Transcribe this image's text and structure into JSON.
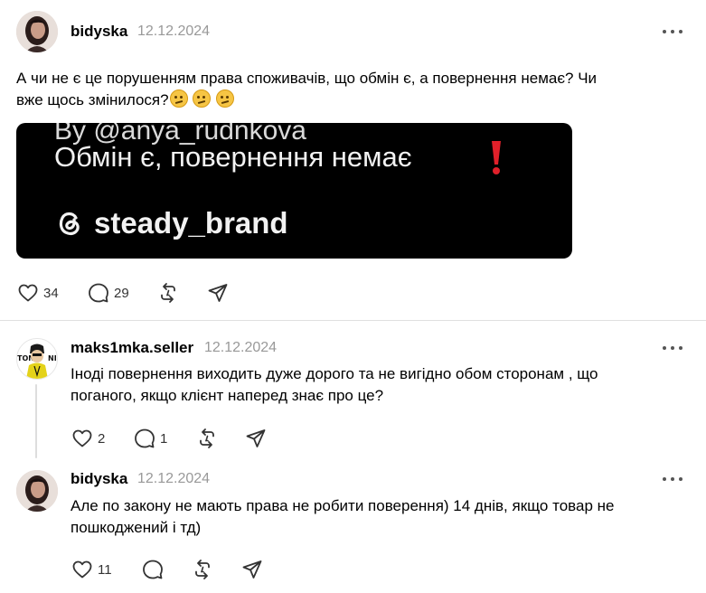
{
  "posts": [
    {
      "username": "bidyska",
      "date": "12.12.2024",
      "text_line1": "А чи не є це порушенням права споживачів, що обмін є, а повернення немає? Чи",
      "text_line2": "вже щось змінилося?",
      "emoji_count": 3,
      "emoji_name": "thinking-face-emoji",
      "media": {
        "line1": "By @anya_rudnkova",
        "line2": "Обмін є, повернення немає",
        "brand": "steady_brand",
        "background": "#000000"
      },
      "likes": "34",
      "replies": "29"
    },
    {
      "username": "maks1mka.seller",
      "date": "12.12.2024",
      "text_line1": "Іноді повернення виходить дуже дорого та не вигідно обом сторонам , що",
      "text_line2": "поганого, якщо клієнт наперед знає про це?",
      "likes": "2",
      "replies": "1"
    },
    {
      "username": "bidyska",
      "date": "12.12.2024",
      "text_line1": "Але по закону не мають права не робити поверення) 14 днів, якщо товар не",
      "text_line2": "пошкоджений і тд)",
      "likes": "11"
    }
  ],
  "icons": {
    "like": "heart-icon",
    "reply": "comment-icon",
    "repost": "repost-icon",
    "share": "send-icon",
    "more": "more-dots-icon"
  },
  "colors": {
    "text": "#000000",
    "secondary": "#999999",
    "divider": "#e0e0e0",
    "icon": "#333333",
    "alert_red": "#e0202a"
  }
}
